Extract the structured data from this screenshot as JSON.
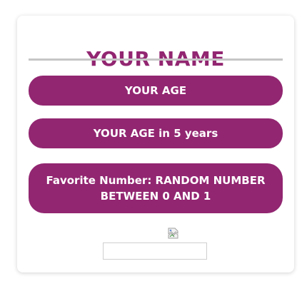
{
  "profile": {
    "name": "YOUR NAME",
    "age": "YOUR AGE",
    "age_in_5": "YOUR AGE in 5 years",
    "favorite_number": "Favorite Number: RANDOM NUMBER BETWEEN 0 AND 1"
  },
  "image": {
    "icon": "broken-image-icon"
  },
  "input": {
    "value": "",
    "placeholder": ""
  },
  "colors": {
    "accent": "#922671",
    "divider": "#c6c6c6",
    "pill_text": "#ffffff"
  }
}
